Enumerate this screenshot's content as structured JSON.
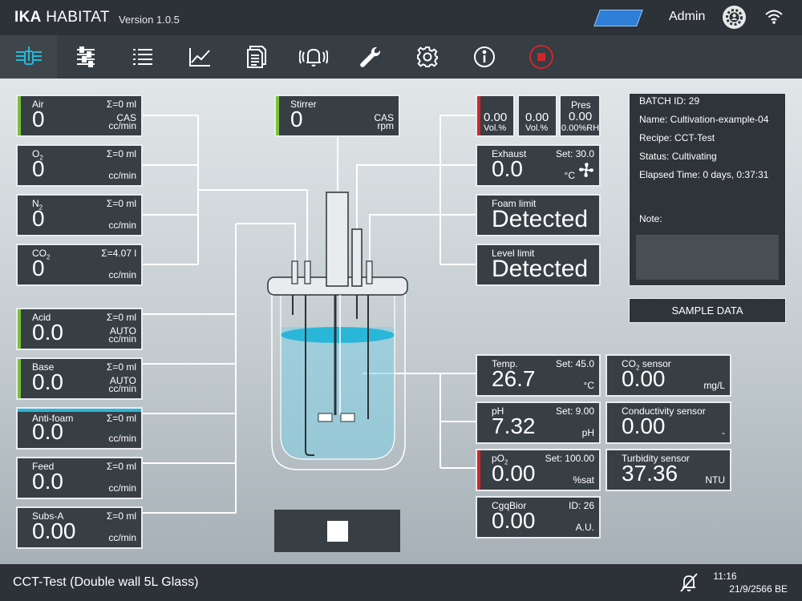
{
  "header": {
    "brand_bold": "IKA",
    "brand_rest": "HABITAT",
    "version": "Version 1.0.5",
    "user": "Admin"
  },
  "iconbar": [
    {
      "name": "bioreactor-overview-icon",
      "active": true
    },
    {
      "name": "control-sliders-icon"
    },
    {
      "name": "list-icon"
    },
    {
      "name": "trend-chart-icon"
    },
    {
      "name": "documents-icon"
    },
    {
      "name": "alarm-bell-icon"
    },
    {
      "name": "wrench-icon"
    },
    {
      "name": "settings-gear-icon"
    },
    {
      "name": "info-icon"
    },
    {
      "name": "stop-record-icon"
    }
  ],
  "feeds": {
    "air": {
      "label": "Air",
      "sum": "Σ=0 ml",
      "mode": "CAS",
      "value": "0",
      "unit": "cc/min"
    },
    "o2": {
      "label": "O",
      "sub": "2",
      "sum": "Σ=0 ml",
      "value": "0",
      "unit": "cc/min"
    },
    "n2": {
      "label": "N",
      "sub": "2",
      "sum": "Σ=0 ml",
      "value": "0",
      "unit": "cc/min"
    },
    "co2": {
      "label": "CO",
      "sub": "2",
      "sum": "Σ=4.07 l",
      "value": "0",
      "unit": "cc/min"
    },
    "acid": {
      "label": "Acid",
      "sum": "Σ=0 ml",
      "mode": "AUTO",
      "value": "0.0",
      "unit": "cc/min"
    },
    "base": {
      "label": "Base",
      "sum": "Σ=0 ml",
      "mode": "AUTO",
      "value": "0.0",
      "unit": "cc/min"
    },
    "antifoam": {
      "label": "Anti-foam",
      "sum": "Σ=0 ml",
      "value": "0.0",
      "unit": "cc/min"
    },
    "feed": {
      "label": "Feed",
      "sum": "Σ=0 ml",
      "value": "0.0",
      "unit": "cc/min"
    },
    "subsa": {
      "label": "Subs-A",
      "sum": "Σ=0 ml",
      "value": "0.00",
      "unit": "cc/min"
    }
  },
  "stirrer": {
    "label": "Stirrer",
    "mode": "CAS",
    "value": "0",
    "unit": "rpm"
  },
  "gas_analyzer": {
    "g1": {
      "value": "0.00",
      "unit": "Vol.%"
    },
    "g2": {
      "value": "0.00",
      "unit": "Vol.%"
    },
    "pres_label": "Pres",
    "pres_value": "0.00",
    "pres_unit": "0.00%RH"
  },
  "exhaust": {
    "label": "Exhaust",
    "set": "Set: 30.0",
    "value": "0.0",
    "unit": "°C"
  },
  "foam": {
    "label": "Foam limit",
    "value": "Detected"
  },
  "level": {
    "label": "Level limit",
    "value": "Detected"
  },
  "batch": {
    "id": "BATCH ID: 29",
    "name": "Name: Cultivation-example-04",
    "recipe": "Recipe: CCT-Test",
    "status": "Status: Cultivating",
    "elapsed": "Elapsed Time: 0 days, 0:37:31",
    "note_label": "Note:"
  },
  "sample_button": "SAMPLE DATA",
  "sensors": {
    "temp": {
      "label": "Temp.",
      "set": "Set: 45.0",
      "value": "26.7",
      "unit": "°C"
    },
    "ph": {
      "label": "pH",
      "set": "Set: 9.00",
      "value": "7.32",
      "unit": "pH"
    },
    "po2": {
      "label": "pO",
      "sub": "2",
      "set": "Set: 100.00",
      "value": "0.00",
      "unit": "%sat"
    },
    "cgq": {
      "label": "CgqBior",
      "set": "ID: 26",
      "value": "0.00",
      "unit": "A.U."
    },
    "co2sensor": {
      "label": "CO",
      "sub": "2",
      "label_rest": " sensor",
      "value": "0.00",
      "unit": "mg/L"
    },
    "conductivity": {
      "label": "Conductivity sensor",
      "value": "0.00",
      "unit": "-"
    },
    "turbidity": {
      "label": "Turbidity sensor",
      "value": "37.36",
      "unit": "NTU"
    }
  },
  "footer": {
    "title": "CCT-Test (Double wall 5L Glass)",
    "time": "11:16",
    "date": "21/9/2566 BE"
  },
  "colors": {
    "accent_green": "#7cc13a",
    "accent_red": "#d0262b",
    "accent_cyan": "#2ab6d8",
    "tile_bg": "#373e44"
  }
}
